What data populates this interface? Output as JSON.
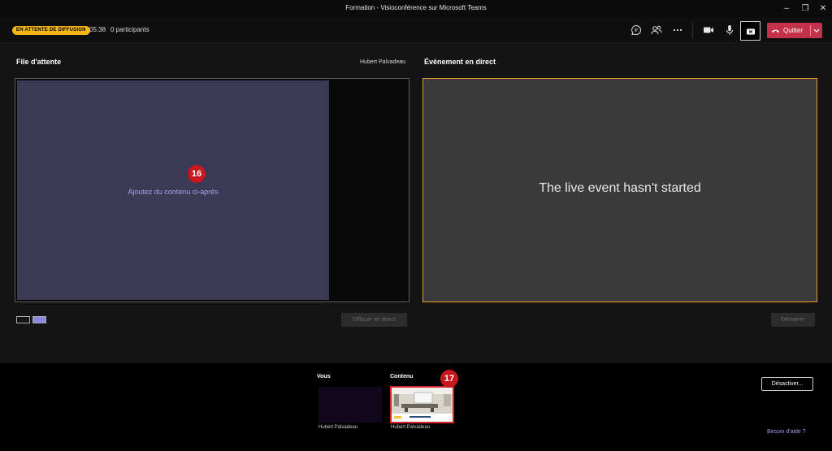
{
  "window": {
    "title": "Formation - Visioconférence sur Microsoft Teams"
  },
  "toolbar": {
    "status_badge": "EN ATTENTE DE DIFFUSION",
    "timer": "05:38",
    "participants": "0 participants",
    "quit_label": "Quitter"
  },
  "queue": {
    "title": "File d'attente",
    "presenter": "Hubert Palvadeau",
    "hint": "Ajoutez du contenu ci-après",
    "marker": "16",
    "broadcast_label": "Diffuser en direct"
  },
  "live": {
    "title": "Événement en direct",
    "message": "The live event hasn't started",
    "start_label": "Démarrer"
  },
  "sources": {
    "you_label": "Vous",
    "content_label": "Contenu",
    "you_name": "Hubert Palvadeau",
    "content_name": "Hubert Palvadeau",
    "marker": "17",
    "deactivate_label": "Désactiver...",
    "help_link": "Besoin d'aide ?"
  },
  "colors": {
    "status_badge": "#f3b615",
    "quit": "#c4314b",
    "live_border": "#e3a127",
    "queue_area": "#3b3a56",
    "marker": "#c8181e"
  }
}
